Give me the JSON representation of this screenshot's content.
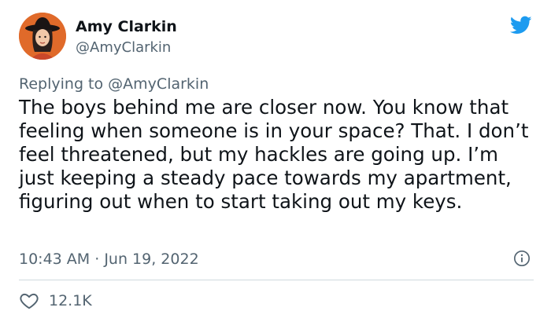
{
  "tweet": {
    "author_name": "Amy Clarkin",
    "author_handle": "@AmyClarkin",
    "reply_prefix": "Replying to",
    "reply_to": "@AmyClarkin",
    "text": "The boys behind me are closer now. You know that feeling when someone is in your space? That. I don’t feel threatened, but my hackles are going up. I’m just keeping a steady pace towards my apartment, figuring out when to start taking out my keys.",
    "time": "10:43 AM",
    "separator": "·",
    "date": "Jun 19, 2022",
    "like_count": "12.1K"
  },
  "colors": {
    "brand": "#1d9bf0",
    "text": "#0f1419",
    "secondary": "#536471",
    "divider": "#cfd9de",
    "avatar_bg": "#e06a2a"
  },
  "icons": {
    "brand": "twitter-bird-icon",
    "info": "info-icon",
    "like": "heart-icon"
  }
}
